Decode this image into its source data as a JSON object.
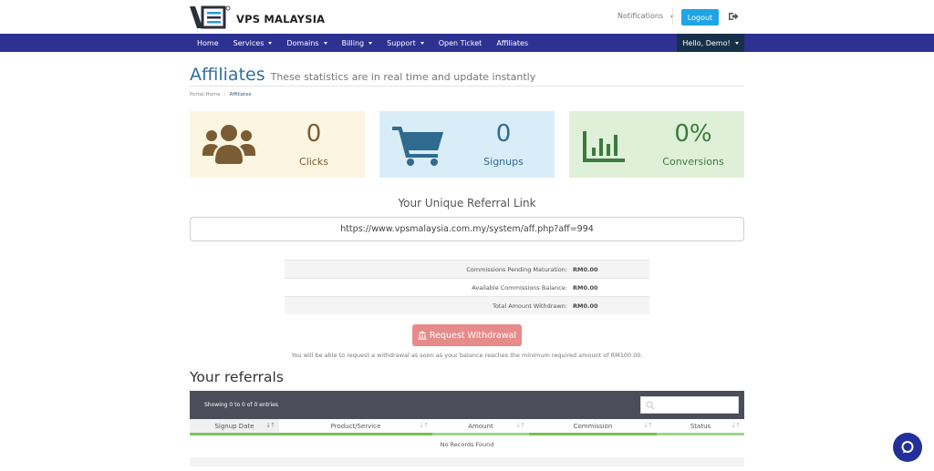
{
  "header": {
    "brand": "VPS MALAYSIA",
    "notifications_label": "Notifications",
    "logout_label": "Logout"
  },
  "nav": {
    "items": [
      {
        "label": "Home",
        "dropdown": false
      },
      {
        "label": "Services",
        "dropdown": true
      },
      {
        "label": "Domains",
        "dropdown": true
      },
      {
        "label": "Billing",
        "dropdown": true
      },
      {
        "label": "Support",
        "dropdown": true
      },
      {
        "label": "Open Ticket",
        "dropdown": false
      },
      {
        "label": "Affiliates",
        "dropdown": false
      }
    ],
    "user_label": "Hello, Demo!"
  },
  "page": {
    "title": "Affiliates",
    "subtitle": "These statistics are in real time and update instantly",
    "breadcrumb": [
      "Portal Home",
      "Affiliates"
    ],
    "breadcrumb_sep": "/"
  },
  "stats": {
    "clicks": {
      "value": "0",
      "label": "Clicks",
      "icon": "users-icon",
      "color": "#7a5d34",
      "bg": "#fcf5e1"
    },
    "signups": {
      "value": "0",
      "label": "Signups",
      "icon": "shopping-cart-icon",
      "color": "#2f6a8f",
      "bg": "#d9edf8"
    },
    "conversions": {
      "value": "0%",
      "label": "Conversions",
      "icon": "bar-chart-icon",
      "color": "#3b7b3c",
      "bg": "#dff0d9"
    }
  },
  "referral": {
    "title": "Your Unique Referral Link",
    "link": "https://www.vpsmalaysia.com.my/system/aff.php?aff=994"
  },
  "commissions": [
    {
      "label": "Commissions Pending Maturation:",
      "value": "RM0.00"
    },
    {
      "label": "Available Commissions Balance:",
      "value": "RM0.00"
    },
    {
      "label": "Total Amount Withdrawn:",
      "value": "RM0.00"
    }
  ],
  "withdraw": {
    "button_label": "Request Withdrawal",
    "note": "You will be able to request a withdrawal as soon as your balance reaches the minimum required amount of RM100.00."
  },
  "referrals": {
    "heading": "Your referrals",
    "info": "Showing 0 to 0 of 0 entries",
    "search_placeholder": "",
    "columns": [
      "Signup Date",
      "Product/Service",
      "Amount",
      "Commission",
      "Status"
    ],
    "empty_text": "No Records Found"
  },
  "colors": {
    "nav_bg": "#2d3192",
    "accent": "#1fa5e6",
    "title": "#2f6fa0",
    "withdraw": "#e78b8a",
    "table_header": "#4b4d5a",
    "chat": "#22309a"
  }
}
